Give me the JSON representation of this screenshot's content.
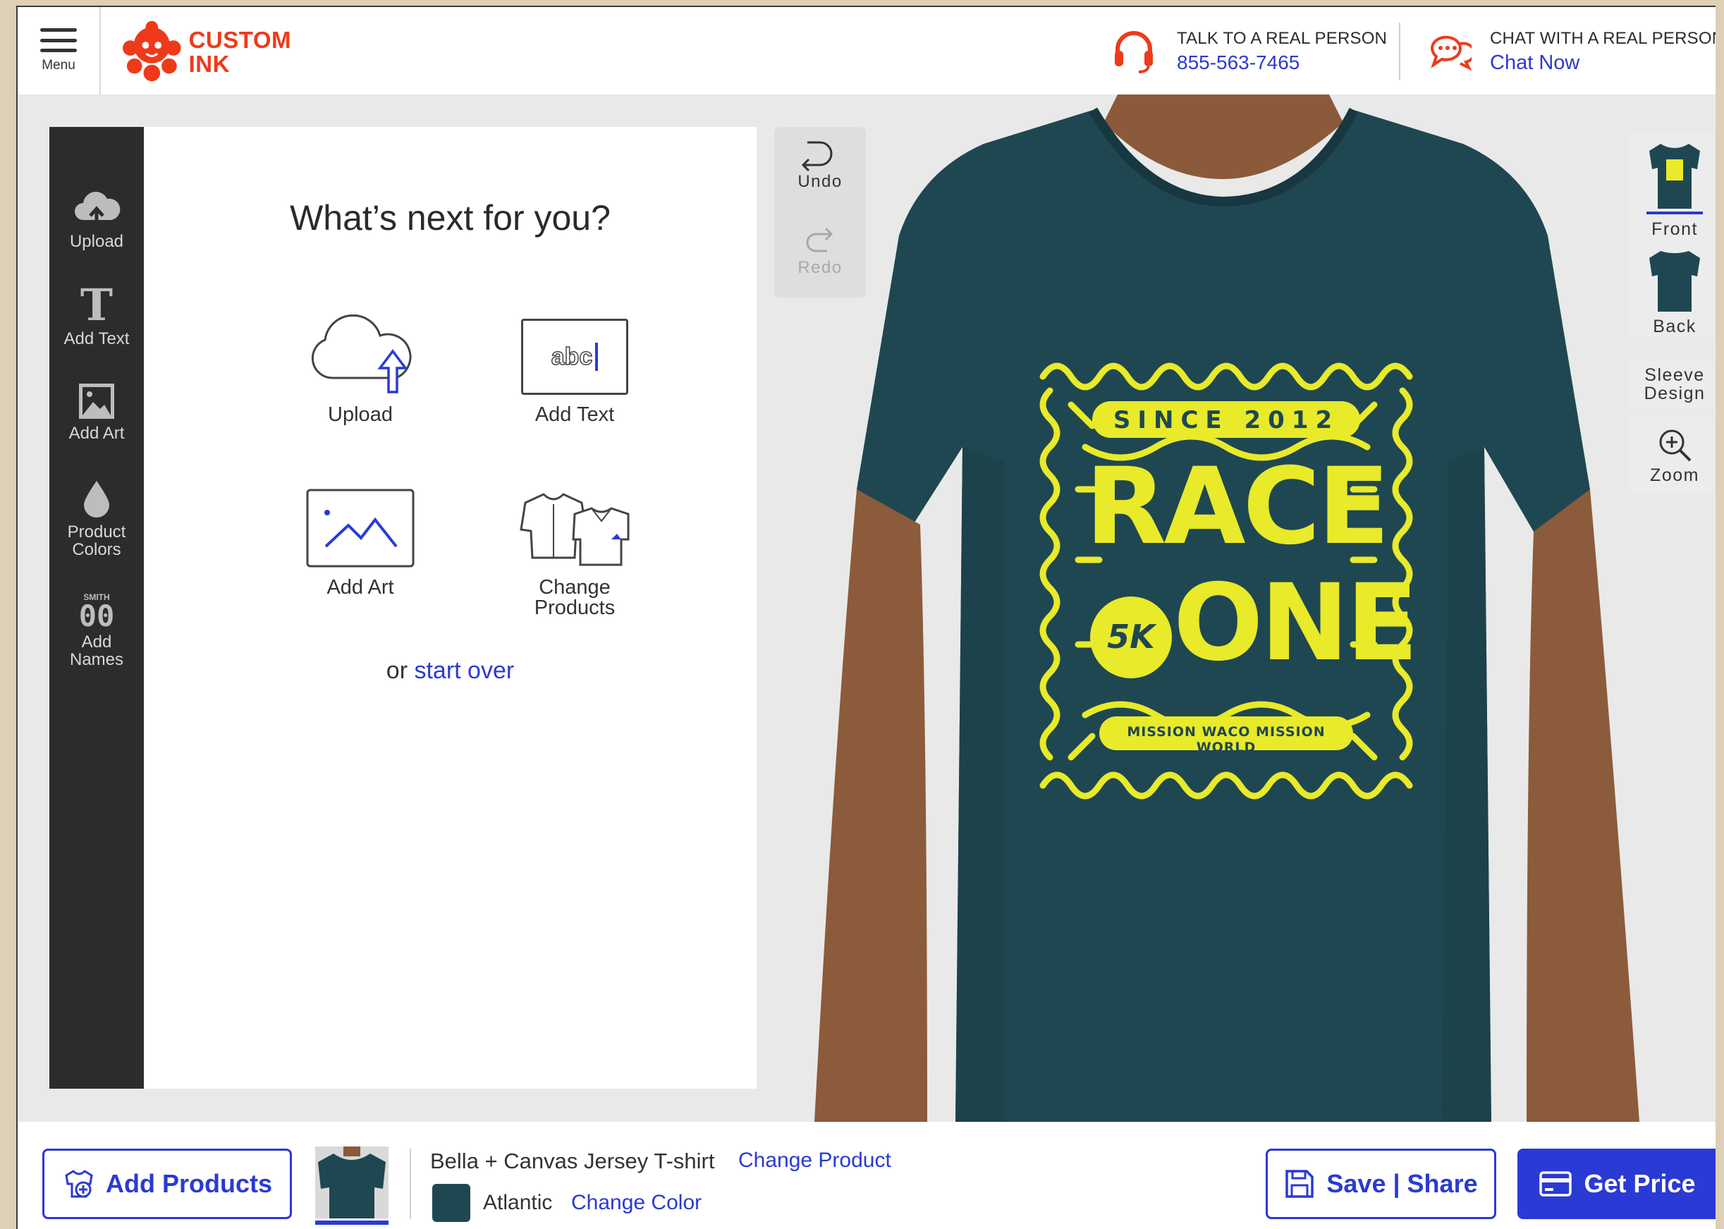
{
  "header": {
    "menu_label": "Menu",
    "logo_line1": "CUSTOM",
    "logo_line2": "INK",
    "talk_label": "TALK TO A REAL PERSON",
    "phone": "855-563-7465",
    "chat_label": "CHAT WITH A REAL PERSON",
    "chat_link": "Chat Now",
    "brand_color": "#ee3a1a",
    "link_color": "#2a3ad4"
  },
  "tools": {
    "upload": "Upload",
    "add_text": "Add Text",
    "add_art": "Add Art",
    "product_colors_1": "Product",
    "product_colors_2": "Colors",
    "add_names_1": "Add",
    "add_names_2": "Names",
    "names_icon_top": "SMITH",
    "names_icon_digits": "00"
  },
  "panel": {
    "title": "What’s next for you?",
    "upload": "Upload",
    "add_text": "Add Text",
    "add_text_sample": "abc",
    "add_art": "Add Art",
    "change_products_1": "Change",
    "change_products_2": "Products",
    "or_text": "or ",
    "start_over": "start over"
  },
  "history": {
    "undo": "Undo",
    "redo": "Redo"
  },
  "design": {
    "since": "SINCE 2012",
    "race": "RACE",
    "one": "ONE",
    "badge": "5K",
    "mission": "MISSION WACO MISSION WORLD",
    "ink_color": "#e8ea2a",
    "shirt_color": "#1f4752"
  },
  "views": {
    "front": "Front",
    "back": "Back",
    "sleeve_1": "Sleeve",
    "sleeve_2": "Design",
    "zoom": "Zoom"
  },
  "footer": {
    "add_products": "Add Products",
    "product_name": "Bella + Canvas Jersey T-shirt",
    "change_product": "Change Product",
    "color_name": "Atlantic",
    "change_color": "Change Color",
    "save_share": "Save | Share",
    "get_price": "Get Price"
  }
}
